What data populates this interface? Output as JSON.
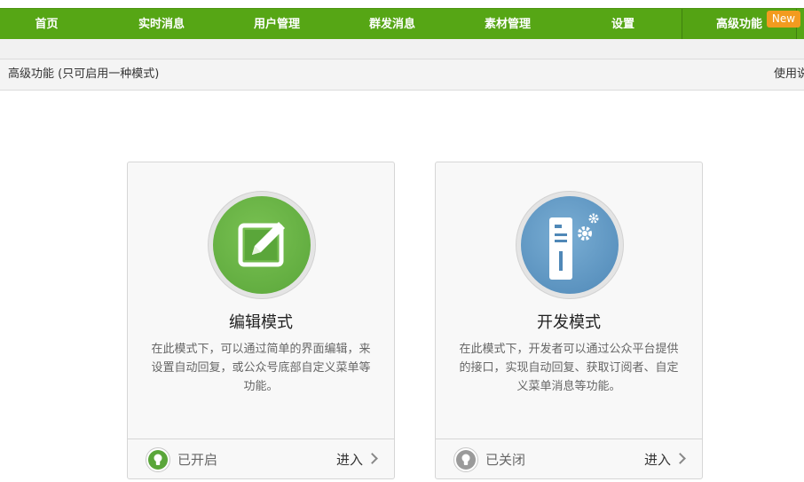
{
  "nav": {
    "items": [
      {
        "label": "首页"
      },
      {
        "label": "实时消息"
      },
      {
        "label": "用户管理"
      },
      {
        "label": "群发消息"
      },
      {
        "label": "素材管理"
      },
      {
        "label": "设置"
      },
      {
        "label": "高级功能"
      }
    ],
    "new_badge": "New"
  },
  "sub_header": {
    "title": "高级功能 (只可启用一种模式)",
    "right_text": "使用说"
  },
  "cards": [
    {
      "title": "编辑模式",
      "description": "在此模式下，可以通过简单的界面编辑，来设置自动回复，或公众号底部自定义菜单等功能。",
      "status": "已开启",
      "enter": "进入",
      "icon": "edit-icon",
      "accent": "#5aa63a"
    },
    {
      "title": "开发模式",
      "description": "在此模式下，开发者可以通过公众平台提供的接口，实现自动回复、获取订阅者、自定义菜单消息等功能。",
      "status": "已关闭",
      "enter": "进入",
      "icon": "server-gear-icon",
      "accent": "#4f88b7"
    }
  ],
  "colors": {
    "nav_bg": "#56a615",
    "badge": "#f39b1f",
    "status_on": "#5aa63a",
    "status_off": "#9a9a9a"
  }
}
